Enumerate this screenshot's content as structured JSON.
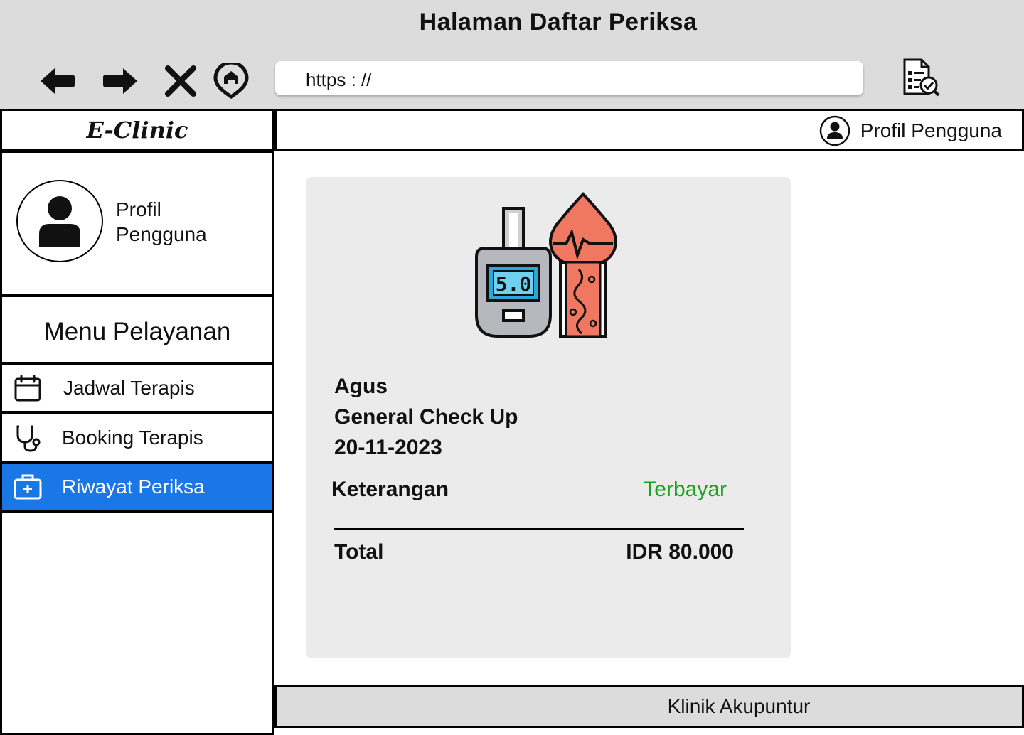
{
  "window": {
    "title": "Halaman Daftar Periksa"
  },
  "browser": {
    "url": "https : //",
    "nav_icons": [
      "back-arrow-icon",
      "forward-arrow-icon",
      "close-icon",
      "home-icon"
    ],
    "action_icon": "document-check-icon"
  },
  "app": {
    "logo": "E-Clinic"
  },
  "topbar": {
    "user_label": "Profil Pengguna",
    "user_icon": "user-circle-icon"
  },
  "sidebar": {
    "profile": {
      "line1": "Profil",
      "line2": "Pengguna"
    },
    "menu_title": "Menu Pelayanan",
    "items": [
      {
        "label": "Jadwal Terapis",
        "icon": "calendar-icon",
        "active": false
      },
      {
        "label": "Booking Terapis",
        "icon": "stethoscope-icon",
        "active": false
      },
      {
        "label": "Riwayat Periksa",
        "icon": "medical-kit-icon",
        "active": true
      }
    ]
  },
  "record": {
    "icon": "glucose-meter-icon",
    "meter_reading": "5.0",
    "patient": "Agus",
    "service": "General Check Up",
    "date": "20-11-2023",
    "note_label": "Keterangan",
    "note_value": "Terbayar",
    "total_label": "Total",
    "total_value": "IDR 80.000"
  },
  "colors": {
    "active": "#1a78e6",
    "paid": "#17a11f",
    "chrome": "#dcdcdc",
    "card": "#ebebeb"
  },
  "footer": {
    "label": "Klinik Akupuntur"
  }
}
